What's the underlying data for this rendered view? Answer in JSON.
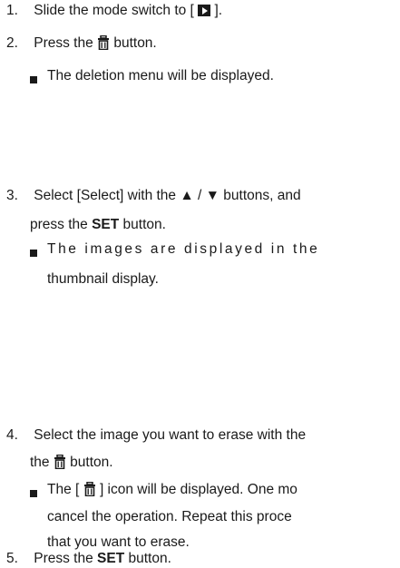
{
  "steps": [
    {
      "num": "1.",
      "pre": "Slide the mode switch to [ ",
      "post": " ]."
    },
    {
      "num": "2.",
      "pre": "Press the ",
      "post": " button."
    },
    {
      "num": "3.",
      "pre": "Select [Select] with the ▲ / ▼ buttons, and",
      "line2_pre": "press the ",
      "line2_bold": "SET",
      "line2_post": " button."
    },
    {
      "num": "4.",
      "pre": "Select the image you want to erase with the",
      "line2_pre": "the ",
      "line2_post": " button."
    },
    {
      "num": "5.",
      "pre": "Press the ",
      "bold": "SET",
      "post": " button."
    }
  ],
  "notes": {
    "step2": "The deletion menu will be displayed.",
    "step3_line1": "The images are displayed in the",
    "step3_line2": "thumbnail display.",
    "step4_line1_pre": "The [ ",
    "step4_line1_post": " ] icon will be displayed. One mo",
    "step4_line2": "cancel the operation. Repeat this proce",
    "step4_line3": "that you want to erase."
  },
  "icons": {
    "play": "play-mode-icon",
    "trash": "trash-icon"
  }
}
